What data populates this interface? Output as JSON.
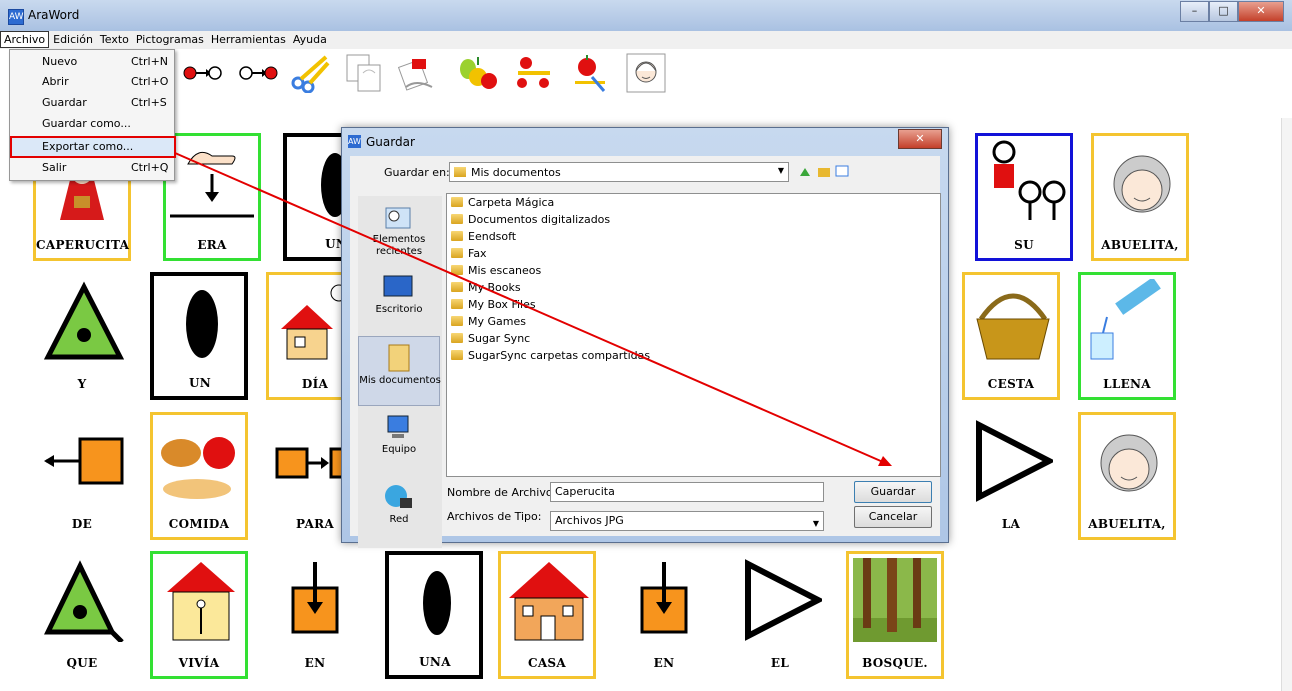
{
  "window": {
    "title": "AraWord",
    "icon": "AW",
    "buttons": [
      "–",
      "□",
      "✕"
    ]
  },
  "menubar": [
    "Archivo",
    "Edición",
    "Texto",
    "Pictogramas",
    "Herramientas",
    "Ayuda"
  ],
  "file_menu": [
    {
      "label": "Nuevo",
      "shortcut": "Ctrl+N"
    },
    {
      "label": "Abrir",
      "shortcut": "Ctrl+O"
    },
    {
      "label": "Guardar",
      "shortcut": "Ctrl+S"
    },
    {
      "label": "Guardar como...",
      "shortcut": ""
    },
    {
      "label": "Exportar como...",
      "shortcut": ""
    },
    {
      "label": "Salir",
      "shortcut": "Ctrl+Q"
    }
  ],
  "toolbar_icons": [
    "circle-arrow-circle-filled-icon",
    "circle-arrow-circle-outline-icon",
    "scissors-icon",
    "copy-icon",
    "paste-icon",
    "fruits-icon",
    "apples-icon",
    "apple-pencil-icon",
    "face-icon"
  ],
  "cards": [
    {
      "word": "CAPERUCITA",
      "icon": "girl-red-hood-icon",
      "border": "yellow"
    },
    {
      "word": "ERA",
      "icon": "hand-down-arrow-icon",
      "border": "green"
    },
    {
      "word": "UNA",
      "icon": "black-oval-icon",
      "border": "black"
    },
    {
      "word": "SU",
      "icon": "family-icon",
      "border": "blue"
    },
    {
      "word": "ABUELITA,",
      "icon": "grandmother-icon",
      "border": "yellow"
    },
    {
      "word": "Y",
      "icon": "triangle-dot-icon",
      "border": "none"
    },
    {
      "word": "UN",
      "icon": "black-oval-icon",
      "border": "black"
    },
    {
      "word": "DÍA",
      "icon": "house-sun-icon",
      "border": "yellow"
    },
    {
      "word": "CESTA",
      "icon": "basket-icon",
      "border": "yellow"
    },
    {
      "word": "LLENA",
      "icon": "pouring-water-icon",
      "border": "green"
    },
    {
      "word": "DE",
      "icon": "arrow-left-square-icon",
      "border": "none"
    },
    {
      "word": "COMIDA",
      "icon": "food-icon",
      "border": "yellow"
    },
    {
      "word": "PARA",
      "icon": "square-arrow-square-icon",
      "border": "none"
    },
    {
      "word": "LA",
      "icon": "triangle-outline-icon",
      "border": "none"
    },
    {
      "word": "ABUELITA,",
      "icon": "grandmother-icon",
      "border": "yellow"
    },
    {
      "word": "QUE",
      "icon": "triangle-dot-tail-icon",
      "border": "none"
    },
    {
      "word": "VIVÍA",
      "icon": "person-in-house-icon",
      "border": "green"
    },
    {
      "word": "EN",
      "icon": "arrow-down-box-icon",
      "border": "none"
    },
    {
      "word": "UNA",
      "icon": "black-oval-icon",
      "border": "black"
    },
    {
      "word": "CASA",
      "icon": "house-icon",
      "border": "yellow"
    },
    {
      "word": "EN",
      "icon": "arrow-down-box-icon",
      "border": "none"
    },
    {
      "word": "EL",
      "icon": "triangle-outline-icon",
      "border": "none"
    },
    {
      "word": "BOSQUE.",
      "icon": "forest-icon",
      "border": "yellow"
    }
  ],
  "dialog": {
    "title": "Guardar",
    "save_in_label": "Guardar en:",
    "save_in_value": "Mis documentos",
    "places": [
      {
        "label": "Elementos recientes",
        "icon": "recent-items-icon"
      },
      {
        "label": "Escritorio",
        "icon": "desktop-icon"
      },
      {
        "label": "Mis documentos",
        "icon": "my-documents-icon"
      },
      {
        "label": "Equipo",
        "icon": "computer-icon"
      },
      {
        "label": "Red",
        "icon": "network-icon"
      }
    ],
    "files": [
      "Carpeta Mágica",
      "Documentos digitalizados",
      "Eendsoft",
      "Fax",
      "Mis escaneos",
      "My Books",
      "My Box Files",
      "My Games",
      "Sugar Sync",
      "SugarSync carpetas compartidas"
    ],
    "filename_label": "Nombre de Archivo:",
    "filename_value": "Caperucita",
    "filetype_label": "Archivos de Tipo:",
    "filetype_value": "Archivos JPG",
    "save_button": "Guardar",
    "cancel_button": "Cancelar"
  },
  "colors": {
    "highlight": "#e30000",
    "card_yellow": "#f4c430",
    "card_green": "#33e033",
    "card_blue": "#1212d8"
  }
}
